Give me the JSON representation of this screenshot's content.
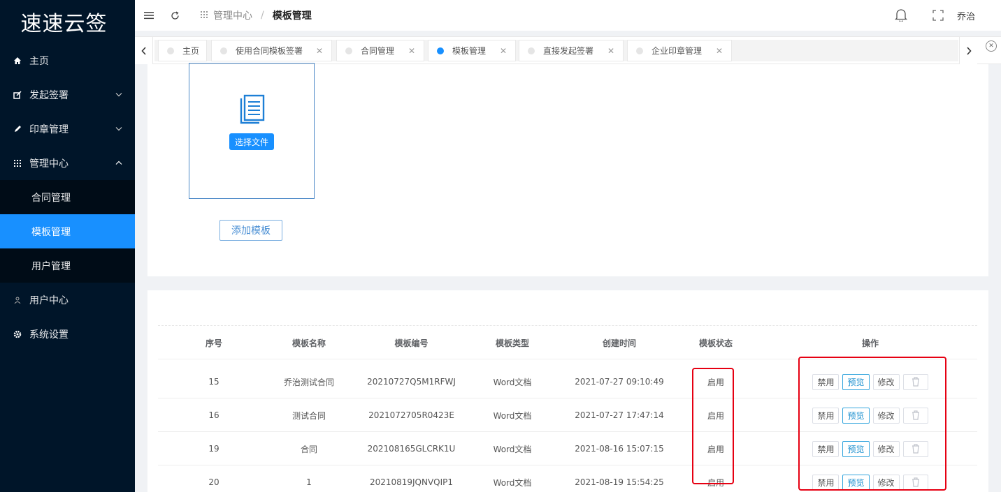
{
  "app": {
    "logo": "速速云签"
  },
  "sidebar": {
    "items": [
      {
        "label": "主页",
        "icon": "home-icon"
      },
      {
        "label": "发起签署",
        "icon": "edit-icon"
      },
      {
        "label": "印章管理",
        "icon": "pen-icon"
      },
      {
        "label": "管理中心",
        "icon": "grid-icon"
      },
      {
        "label": "用户中心",
        "icon": "user-icon"
      },
      {
        "label": "系统设置",
        "icon": "gear-icon"
      }
    ],
    "submenu": [
      {
        "label": "合同管理"
      },
      {
        "label": "模板管理",
        "active": true
      },
      {
        "label": "用户管理"
      }
    ]
  },
  "header": {
    "breadcrumb_parent": "管理中心",
    "breadcrumb_sep": "/",
    "breadcrumb_current": "模板管理",
    "username": "乔治"
  },
  "tabs": [
    {
      "label": "主页",
      "closable": false
    },
    {
      "label": "使用合同模板签署",
      "closable": true
    },
    {
      "label": "合同管理",
      "closable": true
    },
    {
      "label": "模板管理",
      "closable": true,
      "active": true
    },
    {
      "label": "直接发起签署",
      "closable": true
    },
    {
      "label": "企业印章管理",
      "closable": true
    }
  ],
  "upload": {
    "choose_label": "选择文件",
    "add_label": "添加模板"
  },
  "table": {
    "headers": [
      "序号",
      "模板名称",
      "模板编号",
      "模板类型",
      "创建时间",
      "模板状态",
      "操作"
    ],
    "rows": [
      {
        "id": "15",
        "name": "乔治测试合同",
        "code": "20210727Q5M1RFWJ",
        "type": "Word文档",
        "created": "2021-07-27 09:10:49",
        "status": "启用"
      },
      {
        "id": "16",
        "name": "测试合同",
        "code": "2021072705R0423E",
        "type": "Word文档",
        "created": "2021-07-27 17:47:14",
        "status": "启用"
      },
      {
        "id": "19",
        "name": "合同",
        "code": "202108165GLCRK1U",
        "type": "Word文档",
        "created": "2021-08-16 15:07:15",
        "status": "启用"
      },
      {
        "id": "20",
        "name": "1",
        "code": "20210819JQNVQIP1",
        "type": "Word文档",
        "created": "2021-08-19 15:54:25",
        "status": "启用"
      }
    ],
    "actions": {
      "disable": "禁用",
      "preview": "预览",
      "edit": "修改"
    }
  },
  "colors": {
    "sidebar": "#001529",
    "accent": "#1890ff",
    "highlight": "#e60012"
  }
}
